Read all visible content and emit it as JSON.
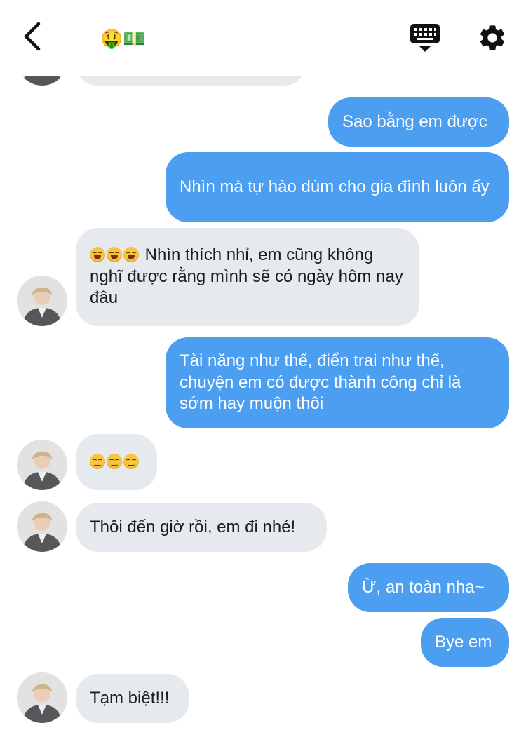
{
  "header": {
    "back_icon": "chevron-left-icon",
    "title": "🤑💵",
    "keyboard_icon": "keyboard-icon",
    "settings_icon": "gear-icon"
  },
  "colors": {
    "incoming_bubble": "#e6e9ee",
    "outgoing_bubble": "#4c9ff0",
    "background": "#ffffff"
  },
  "messages": [
    {
      "from": "me",
      "text": "Sao bằng em được"
    },
    {
      "from": "me",
      "text": "Nhìn mà tự hào dùm cho gia đình luôn ấy"
    },
    {
      "from": "other",
      "emoji": "😆😆😆",
      "text": "Nhìn thích nhỉ, em cũng không nghĩ được rằng mình sẽ có ngày hôm nay đâu"
    },
    {
      "from": "me",
      "text": "Tài năng như thế, điển trai như thế, chuyện em có được thành công chỉ là sớm hay muộn thôi"
    },
    {
      "from": "other",
      "emoji": "☺️☺️☺️",
      "text": ""
    },
    {
      "from": "other",
      "text": "Thôi đến giờ rồi, em đi nhé!"
    },
    {
      "from": "me",
      "text": "Ừ, an toàn nha~"
    },
    {
      "from": "me",
      "text": "Bye em"
    },
    {
      "from": "other",
      "text": "Tạm biệt!!!"
    }
  ]
}
